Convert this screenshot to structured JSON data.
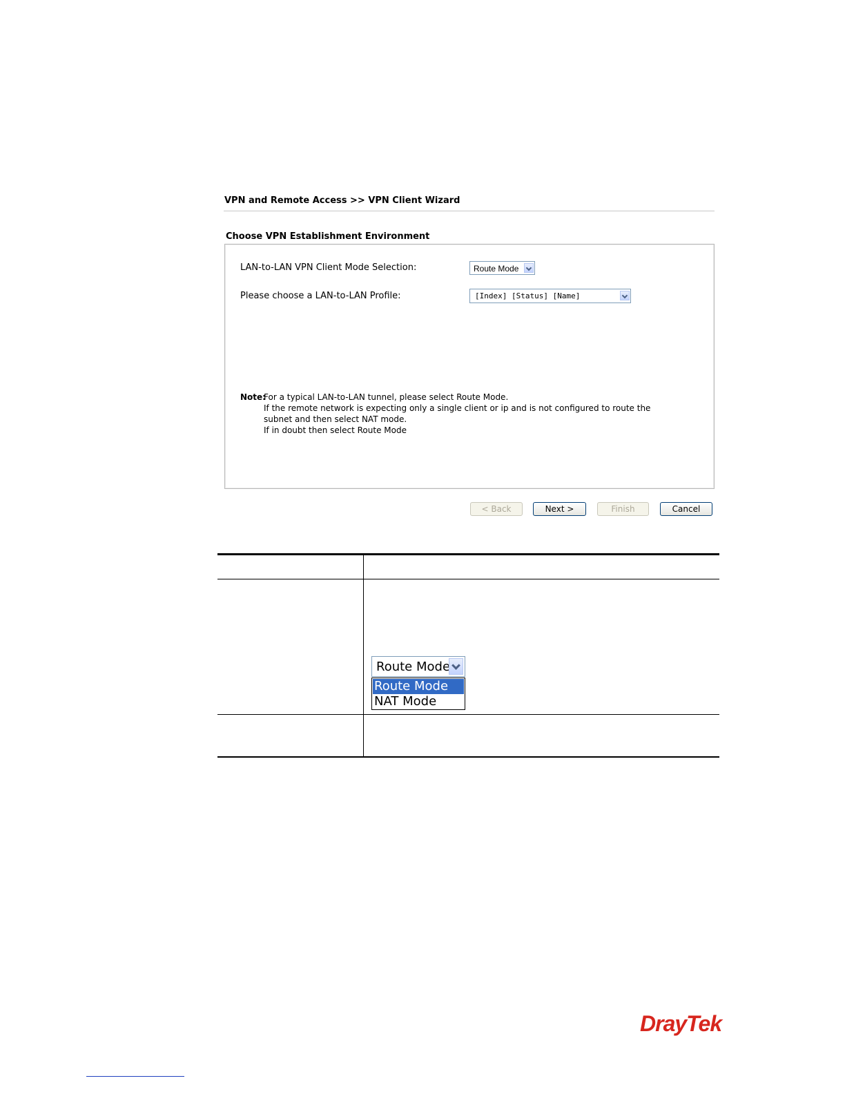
{
  "header": {
    "breadcrumb": "VPN and Remote Access >> VPN Client Wizard",
    "section_title": "Choose VPN Establishment Environment"
  },
  "form": {
    "mode_label": "LAN-to-LAN VPN Client Mode Selection:",
    "mode_value": "Route Mode",
    "profile_label": "Please choose a LAN-to-LAN Profile:",
    "profile_value": "[Index] [Status] [Name]"
  },
  "note": {
    "label": "Note:",
    "lines": [
      "For a typical LAN-to-LAN tunnel, please select Route Mode.",
      "If the remote network is expecting only a single client or ip and is not configured to route the",
      "subnet and then select NAT mode.",
      "If in doubt then select Route Mode"
    ]
  },
  "buttons": {
    "back": "< Back",
    "next": "Next >",
    "finish": "Finish",
    "cancel": "Cancel"
  },
  "dropdown_example": {
    "selected": "Route Mode",
    "options": [
      "Route Mode",
      "NAT Mode"
    ]
  },
  "brand": {
    "logo_text": "DrayTek",
    "logo_color": "#d7261e"
  }
}
